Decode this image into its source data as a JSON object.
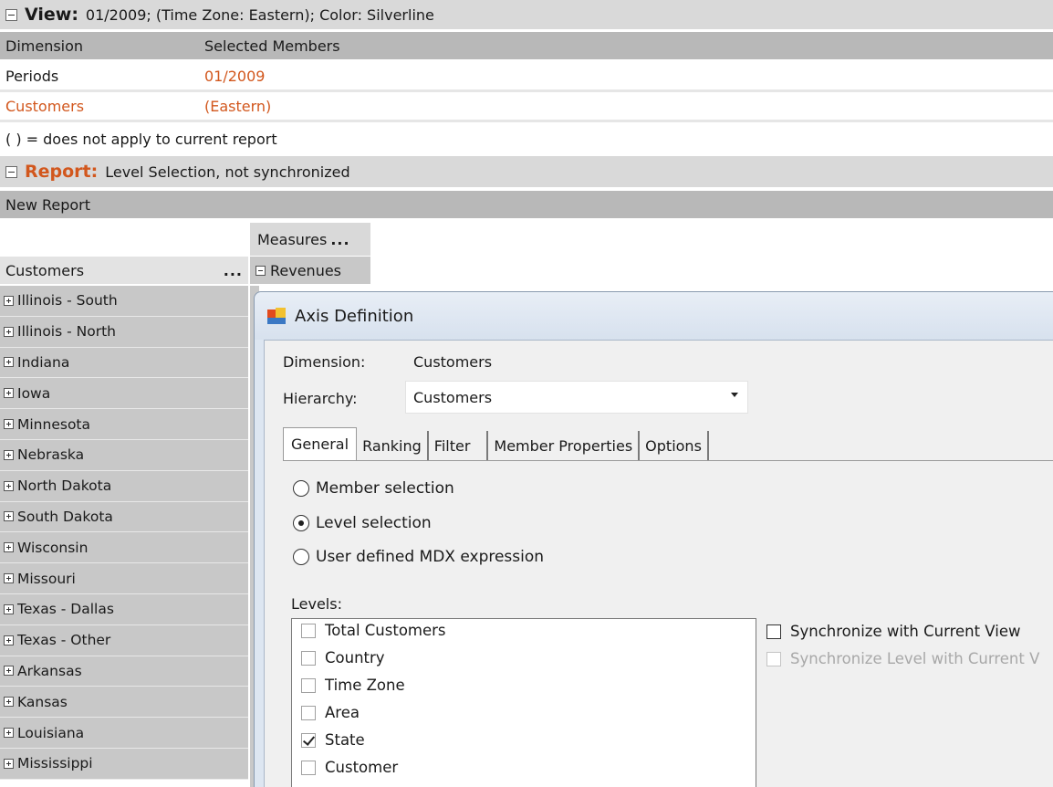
{
  "view": {
    "title": "View:",
    "summary": "01/2009; (Time Zone: Eastern); Color: Silverline",
    "table_headers": [
      "Dimension",
      "Selected Members"
    ],
    "rows": [
      {
        "dimension": "Periods",
        "members": "01/2009"
      },
      {
        "dimension": "Customers",
        "members": "(Eastern)"
      }
    ],
    "note": "( ) = does not apply to current report"
  },
  "report": {
    "title": "Report:",
    "summary": "Level Selection, not synchronized",
    "name": "New Report"
  },
  "grid": {
    "measures_label": "Measures",
    "customers_label": "Customers",
    "revenues_label": "Revenues",
    "ellipsis": "...",
    "members": [
      "Illinois - South",
      "Illinois - North",
      "Indiana",
      "Iowa",
      "Minnesota",
      "Nebraska",
      "North Dakota",
      "South Dakota",
      "Wisconsin",
      "Missouri",
      "Texas - Dallas",
      "Texas - Other",
      "Arkansas",
      "Kansas",
      "Louisiana",
      "Mississippi"
    ]
  },
  "dialog": {
    "title": "Axis Definition",
    "dimension_label": "Dimension:",
    "dimension_value": "Customers",
    "hierarchy_label": "Hierarchy:",
    "hierarchy_value": "Customers",
    "tabs": [
      "General",
      "Ranking",
      "Filter",
      "Member Properties",
      "Options"
    ],
    "active_tab": "General",
    "radios": [
      {
        "label": "Member selection",
        "selected": false
      },
      {
        "label": "Level selection",
        "selected": true
      },
      {
        "label": "User defined MDX expression",
        "selected": false
      }
    ],
    "levels_label": "Levels:",
    "levels": [
      {
        "label": "Total Customers",
        "checked": false
      },
      {
        "label": "Country",
        "checked": false
      },
      {
        "label": "Time Zone",
        "checked": false
      },
      {
        "label": "Area",
        "checked": false
      },
      {
        "label": "State",
        "checked": true
      },
      {
        "label": "Customer",
        "checked": false
      }
    ],
    "sync_view_label": "Synchronize with Current View",
    "sync_view_checked": false,
    "sync_level_label": "Synchronize Level with Current V",
    "sync_level_enabled": false
  },
  "colors": {
    "accent_orange": "#d2571d",
    "header_gray": "#b8b8b8",
    "member_gray": "#c8c8c8"
  }
}
